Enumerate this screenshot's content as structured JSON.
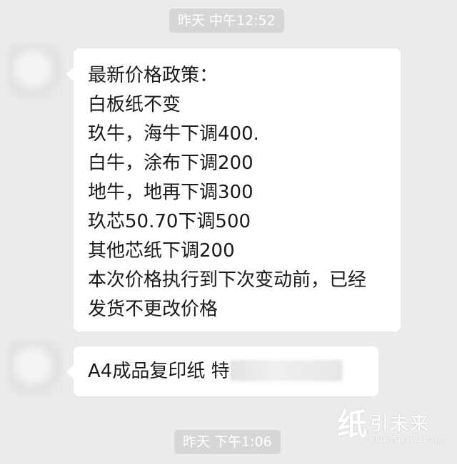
{
  "timestamps": [
    "昨天 中午12:52",
    "昨天 下午1:06"
  ],
  "messages": [
    {
      "lines": [
        "最新价格政策：",
        "白板纸不变",
        "玖牛，海牛下调400.",
        "白牛，涂布下调200",
        "地牛，地再下调300",
        "玖芯50.70下调500",
        "其他芯纸下调200",
        "本次价格执行到下次变动前，已经",
        "发货不更改价格"
      ]
    },
    {
      "text": "A4成品复印纸 特"
    }
  ],
  "watermark": {
    "logo_char": "纸",
    "name": "引未来",
    "url": "www.5izyw1.com"
  }
}
